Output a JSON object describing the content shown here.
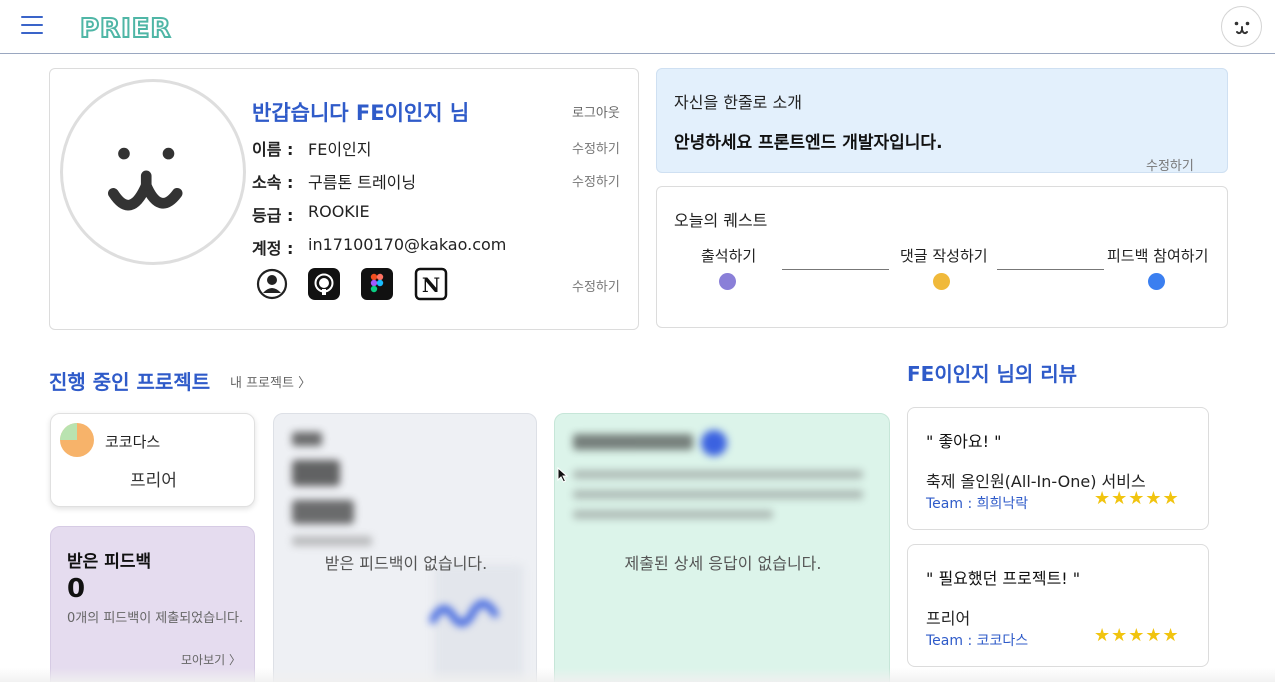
{
  "header": {
    "logo_text": "PRIER",
    "icon_menu": "hamburger-icon",
    "icon_profile": "bear-face-icon"
  },
  "profile": {
    "greeting": "반갑습니다 FE이인지 님",
    "logout": "로그아웃",
    "fields": [
      {
        "label": "이름 :",
        "value": "FE이인지",
        "edit": "수정하기"
      },
      {
        "label": "소속 :",
        "value": "구름톤 트레이닝",
        "edit": "수정하기"
      },
      {
        "label": "등급 :",
        "value": "ROOKIE",
        "edit": ""
      },
      {
        "label": "계정 :",
        "value": "in17100170@kakao.com",
        "edit": ""
      }
    ],
    "social_edit": "수정하기",
    "social_icons": [
      "user-circle-icon",
      "github-icon",
      "figma-icon",
      "notion-icon"
    ]
  },
  "intro": {
    "title": "자신을 한줄로 소개",
    "text": "안녕하세요 프론트엔드 개발자입니다.",
    "edit": "수정하기"
  },
  "quest": {
    "title": "오늘의 퀘스트",
    "items": [
      {
        "label": "출석하기",
        "color": "#8a7fd8"
      },
      {
        "label": "댓글 작성하기",
        "color": "#f0b93a"
      },
      {
        "label": "피드백 참여하기",
        "color": "#3b7ff0"
      }
    ]
  },
  "projects": {
    "title": "진행 중인 프로젝트",
    "my_link": "내 프로젝트 〉",
    "current": {
      "team": "코코다스",
      "name": "프리어"
    },
    "feedback": {
      "title": "받은 피드백",
      "count": "0",
      "desc": "0개의 피드백이 제출되었습니다.",
      "more": "모아보기 〉"
    },
    "stats": {
      "empty": "받은 피드백이 없습니다."
    },
    "ai": {
      "empty": "제출된 상세 응답이 없습니다."
    }
  },
  "reviews": {
    "title": "FE이인지 님의 리뷰",
    "items": [
      {
        "quote": "\" 좋아요! \"",
        "project": "축제 올인원(All-In-One) 서비스",
        "team": "Team : 희희낙락",
        "stars": "★★★★★"
      },
      {
        "quote": "\" 필요했던 프로젝트! \"",
        "project": "프리어",
        "team": "Team : 코코다스",
        "stars": "★★★★★"
      }
    ]
  },
  "colors": {
    "accent": "#2f5bc9",
    "intro_bg": "#e3f0fc",
    "feedback_bg": "#e5dcef",
    "stats_bg": "#eef0f4",
    "ai_bg": "#dcf4ea",
    "star": "#f1c40f"
  }
}
